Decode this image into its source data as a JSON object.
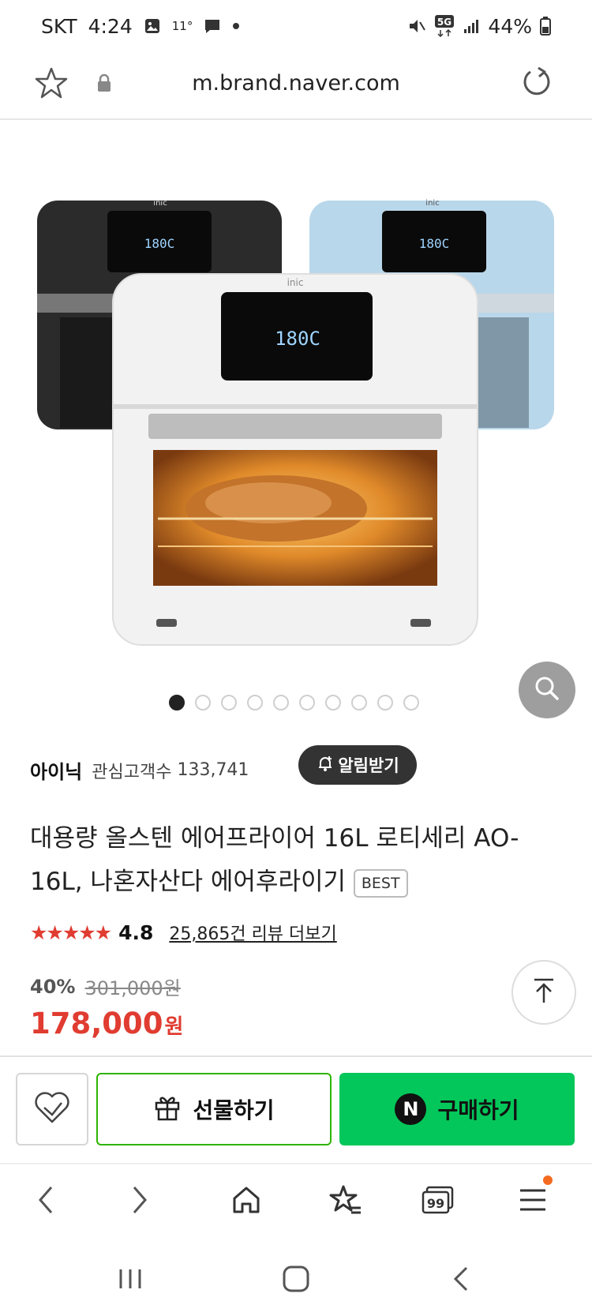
{
  "status": {
    "carrier": "SKT",
    "time": "4:24",
    "temp": "11°",
    "network": "5G",
    "battery": "44%"
  },
  "browser": {
    "url": "m.brand.naver.com"
  },
  "product": {
    "brand": "아이닉",
    "fans_label": "관심고객수",
    "fans_count": "133,741",
    "alarm_label": "알림받기",
    "title": "대용량 올스텐 에어프라이어 16L 로티세리 AO-16L, 나혼자산다 에어후라이기",
    "badge": "BEST",
    "stars": "★★★★★",
    "rating": 4.8,
    "reviews": "25,865건 리뷰 더보기",
    "discount": "40%",
    "original_price": "301,000원",
    "price": "178,000",
    "price_unit": "원",
    "image_count": 10,
    "active_image": 1,
    "display_text": "180C"
  },
  "actions": {
    "gift_label": "선물하기",
    "buy_label": "구매하기",
    "buy_logo": "N"
  },
  "browser_nav": {
    "tabs_count": "99"
  },
  "colors": {
    "accent_green": "#03c75a",
    "price_red": "#e03c31",
    "dark_button": "#333333",
    "notification_dot": "#f26b21"
  }
}
